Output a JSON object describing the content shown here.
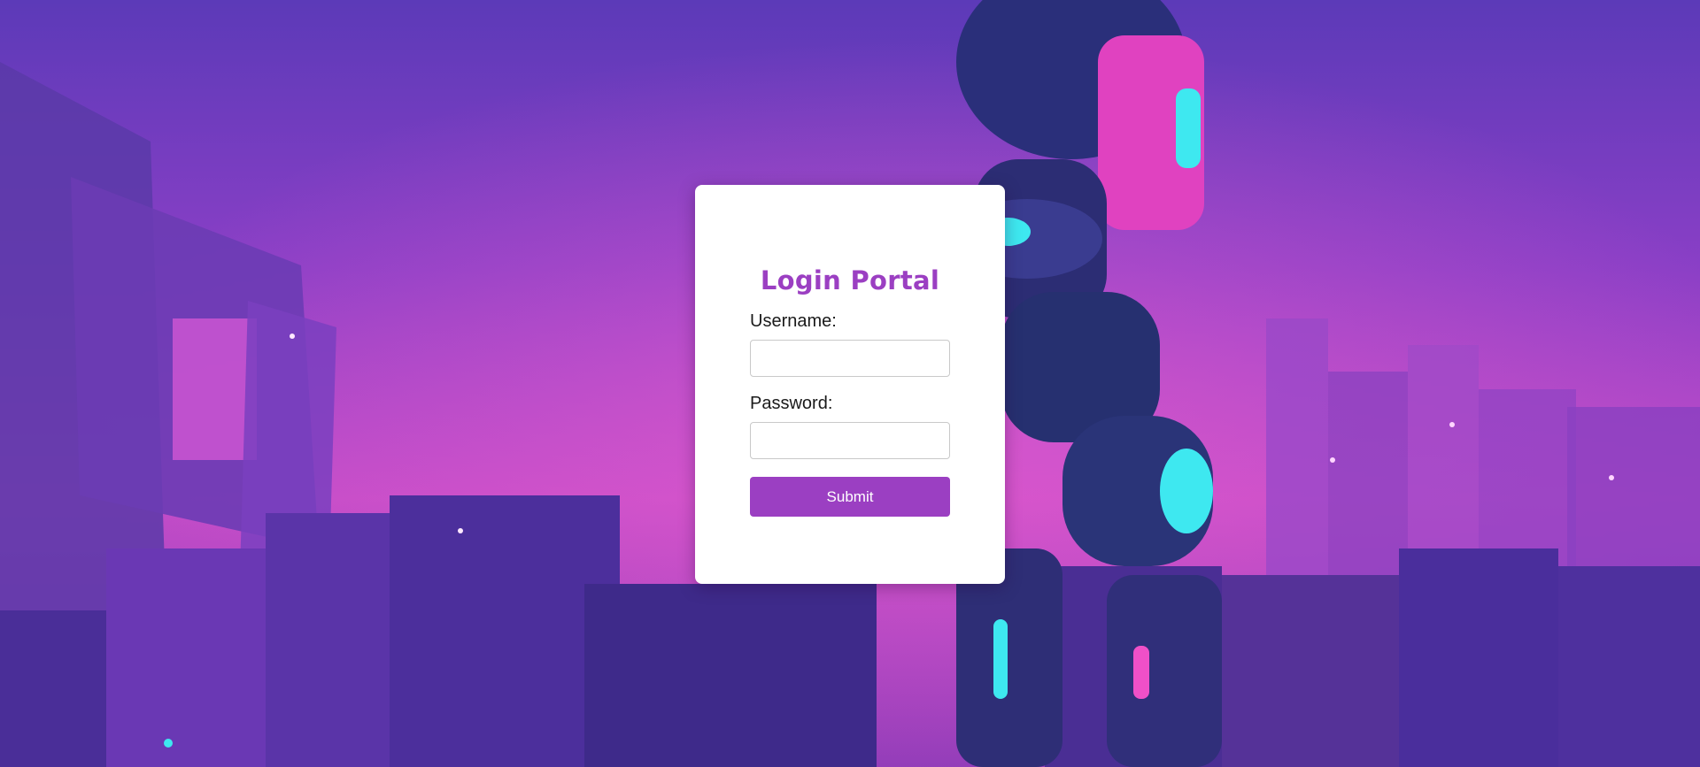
{
  "login": {
    "title": "Login Portal",
    "username_label": "Username:",
    "username_value": "",
    "password_label": "Password:",
    "password_value": "",
    "submit_label": "Submit"
  },
  "colors": {
    "accent": "#9b3fc2",
    "card_background": "#ffffff",
    "background_purple": "#8a3fc4",
    "background_pink": "#d04ac8",
    "background_cyan": "#3ee8f0"
  }
}
